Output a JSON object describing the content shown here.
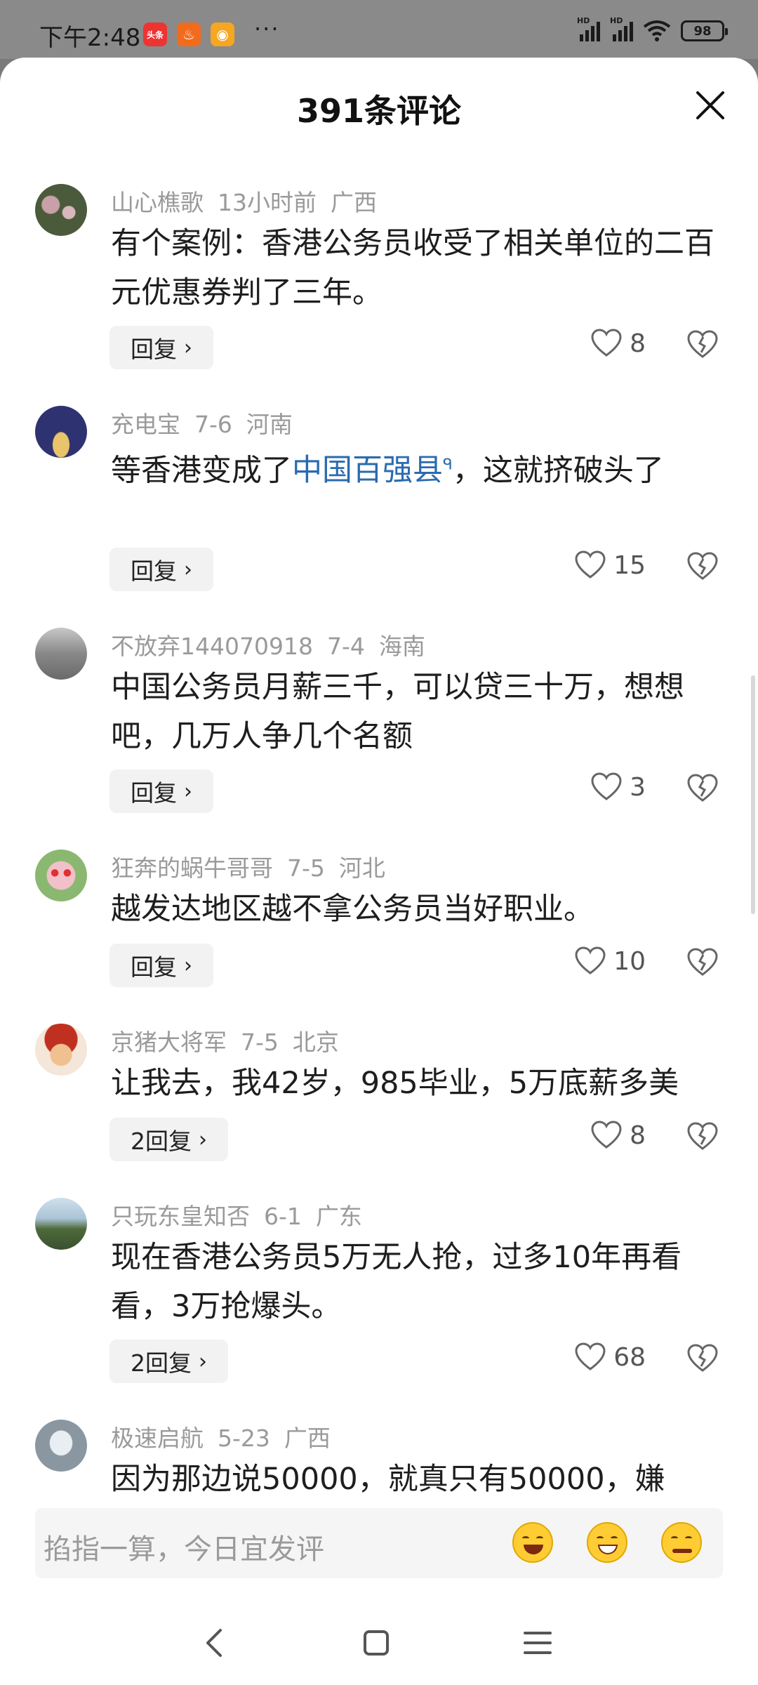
{
  "status_bar": {
    "time": "下午2:48",
    "app_icons": [
      "toutiao-app-icon",
      "orange-app-icon",
      "weibo-app-icon"
    ],
    "toutiao_label": "头条",
    "more": "···",
    "signal_label_1": "HD",
    "signal_label_2": "HD",
    "battery": "98"
  },
  "header": {
    "title": "391条评论",
    "close_icon": "close-icon"
  },
  "comments": [
    {
      "user": "山心樵歌",
      "time": "13小时前",
      "region": "广西",
      "text": "有个案例：香港公务员收受了相关单位的二百元优惠券判了三年。",
      "reply_label": "回复",
      "likes": "8"
    },
    {
      "user": "充电宝",
      "time": "7-6",
      "region": "河南",
      "text_before": "等香港变成了",
      "link_text": "中国百强县",
      "link_marker": "ᑫ",
      "text_after": "，这就挤破头了",
      "reply_label": "回复",
      "likes": "15"
    },
    {
      "user": "不放弃144070918",
      "time": "7-4",
      "region": "海南",
      "text": "中国公务员月薪三千，可以贷三十万，想想吧，几万人争几个名额",
      "reply_label": "回复",
      "likes": "3"
    },
    {
      "user": "狂奔的蜗牛哥哥",
      "time": "7-5",
      "region": "河北",
      "text": "越发达地区越不拿公务员当好职业。",
      "reply_label": "回复",
      "likes": "10"
    },
    {
      "user": "京猪大将军",
      "time": "7-5",
      "region": "北京",
      "text": "让我去，我42岁，985毕业，5万底薪多美",
      "reply_label": "2回复",
      "likes": "8"
    },
    {
      "user": "只玩东皇知否",
      "time": "6-1",
      "region": "广东",
      "text": "现在香港公务员5万无人抢，过多10年再看看，3万抢爆头。",
      "reply_label": "2回复",
      "likes": "68"
    },
    {
      "user": "极速启航",
      "time": "5-23",
      "region": "广西",
      "text": "因为那边说50000，就真只有50000，嫌"
    }
  ],
  "input_bar": {
    "placeholder": "掐指一算，今日宜发评",
    "emojis": [
      "laughing-emoji",
      "grinning-emoji",
      "thinking-emoji"
    ]
  },
  "nav_bar": {
    "icons": [
      "back-icon",
      "home-icon",
      "menu-icon"
    ]
  },
  "colors": {
    "link": "#2a6bb0",
    "meta_text": "#9a9a9a",
    "reply_bg": "#f2f2f2"
  }
}
